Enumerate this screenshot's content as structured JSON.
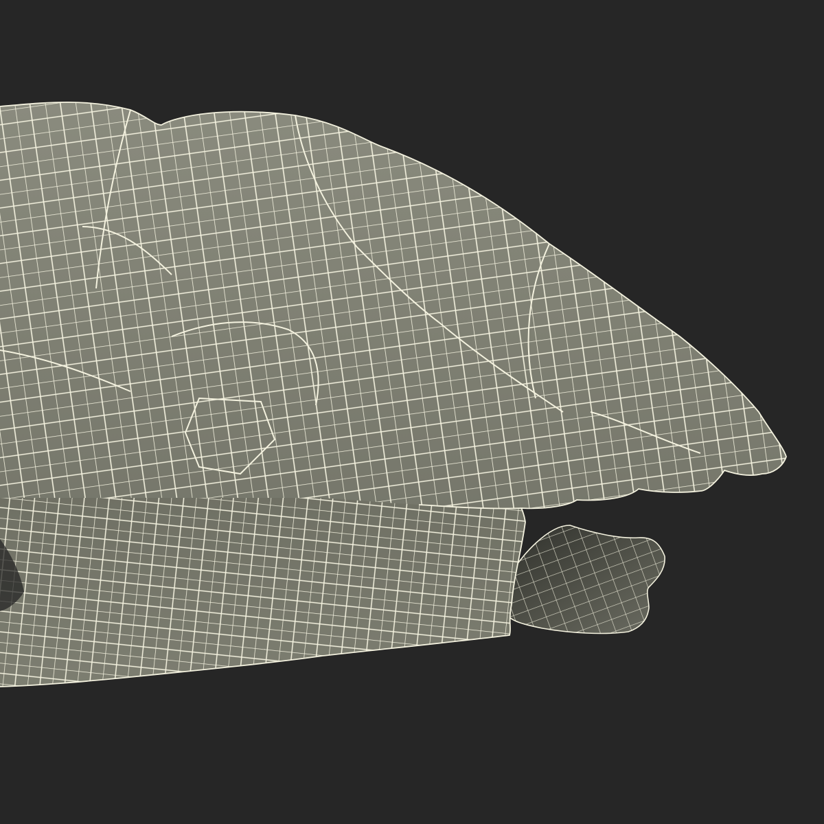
{
  "scene": {
    "background_color": "#262626",
    "subject": "turtle-wireframe-render",
    "colors": {
      "shell_fill": "#7f8073",
      "shell_highlight": "#8a8b7e",
      "body_fill": "#7a7b6e",
      "underside_dark": "#2e2f2a",
      "flipper_fill": "#5a5b52",
      "wire": "#f4f2df"
    }
  }
}
